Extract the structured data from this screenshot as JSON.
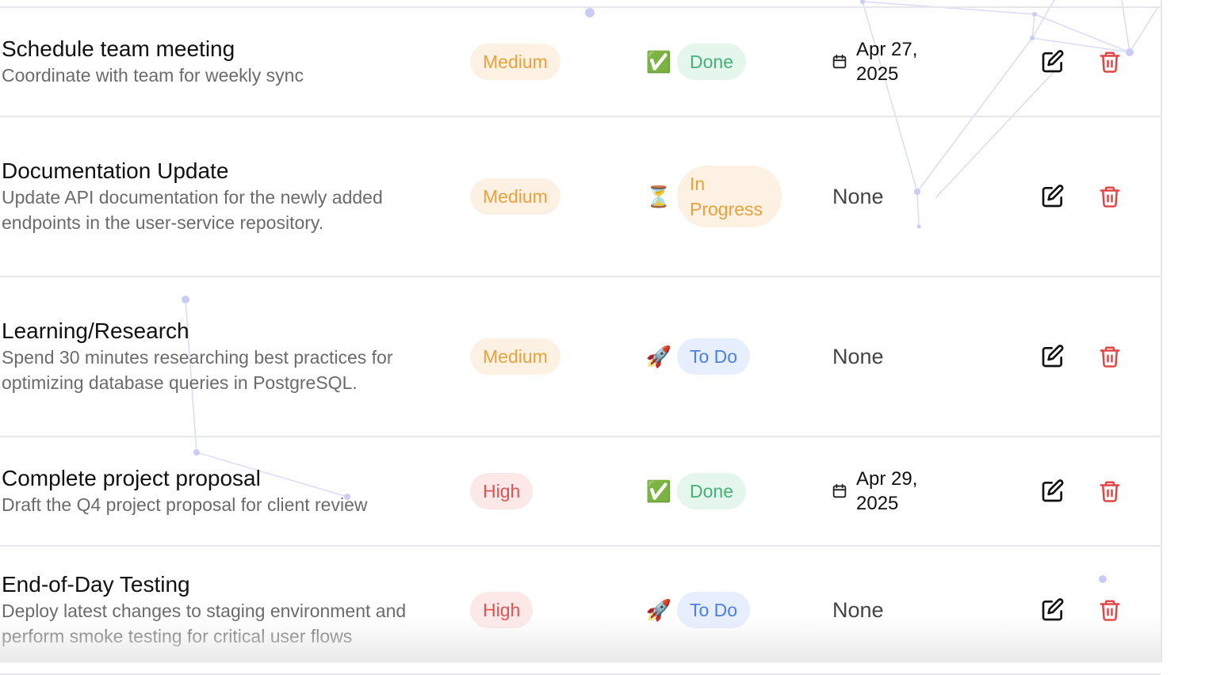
{
  "tasks": [
    {
      "title": "Schedule team meeting",
      "description": "Coordinate with team for weekly sync",
      "priority": "Medium",
      "priority_level": "medium",
      "status": "Done",
      "status_emoji": "✅",
      "status_key": "done",
      "due": "Apr 27, 2025",
      "has_due": true
    },
    {
      "title": "Documentation Update",
      "description": "Update API documentation for the newly added endpoints in the user-service repository.",
      "priority": "Medium",
      "priority_level": "medium",
      "status": "In Progress",
      "status_emoji": "⏳",
      "status_key": "progress",
      "due": "None",
      "has_due": false
    },
    {
      "title": "Learning/Research",
      "description": "Spend 30 minutes researching best practices for optimizing database queries in PostgreSQL.",
      "priority": "Medium",
      "priority_level": "medium",
      "status": "To Do",
      "status_emoji": "🚀",
      "status_key": "todo",
      "due": "None",
      "has_due": false
    },
    {
      "title": "Complete project proposal",
      "description": "Draft the Q4 project proposal for client review",
      "priority": "High",
      "priority_level": "high",
      "status": "Done",
      "status_emoji": "✅",
      "status_key": "done",
      "due": "Apr 29, 2025",
      "has_due": true
    },
    {
      "title": "End-of-Day Testing",
      "description": "Deploy latest changes to staging environment and perform smoke testing for critical user flows",
      "priority": "High",
      "priority_level": "high",
      "status": "To Do",
      "status_emoji": "🚀",
      "status_key": "todo",
      "due": "None",
      "has_due": false
    }
  ],
  "icons": {
    "edit": "edit-icon",
    "delete": "trash-icon",
    "calendar": "calendar-icon"
  },
  "colors": {
    "medium_text": "#e8a23c",
    "medium_bg": "#fdf1e3",
    "high_text": "#e05353",
    "high_bg": "#fde8e8",
    "done_text": "#44b07a",
    "done_bg": "#e5f6ec",
    "todo_text": "#4c7fe0",
    "todo_bg": "#e7eefd",
    "delete_icon": "#e04646"
  }
}
